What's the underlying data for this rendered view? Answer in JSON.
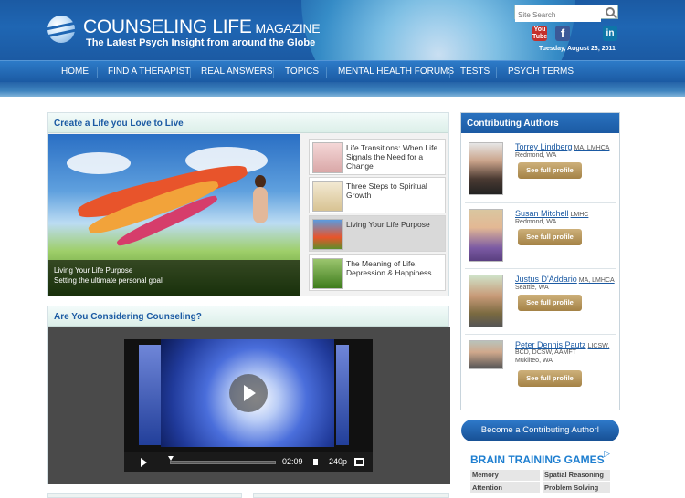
{
  "header": {
    "brand": "COUNSELING LIFE",
    "brand_suffix": "MAGAZINE",
    "tagline": "The Latest Psych Insight from around the Globe",
    "search_placeholder": "Site Search",
    "youtube_label": "You Tube",
    "facebook_label": "f",
    "linkedin_label": "in",
    "date": "Tuesday, August 23, 2011"
  },
  "nav": {
    "items": [
      "HOME",
      "FIND A THERAPIST",
      "REAL ANSWERS",
      "TOPICS",
      "MENTAL HEALTH FORUMS",
      "TESTS",
      "PSYCH TERMS"
    ]
  },
  "feature": {
    "title": "Create a Life you Love to Live",
    "caption_title": "Living Your Life Purpose",
    "caption_sub": "Setting the ultimate personal goal",
    "articles": [
      "Life Transitions: When Life Signals the Need for a Change",
      "Three Steps to Spiritual Growth",
      "Living Your Life Purpose",
      "The Meaning of Life, Depression & Happiness"
    ]
  },
  "video": {
    "title": "Are You Considering Counseling?",
    "time": "02:09",
    "quality": "240p",
    "progress": 0.0
  },
  "authors": {
    "title": "Contributing Authors",
    "button": "See full profile",
    "list": [
      {
        "name": "Torrey Lindberg",
        "cred": "MA, LMHCA",
        "loc": "Redmond, WA"
      },
      {
        "name": "Susan Mitchell",
        "cred": "LMHC",
        "loc": "Redmond, WA"
      },
      {
        "name": "Justus D'Addario",
        "cred": "MA, LMHCA",
        "loc": "Seattle, WA"
      },
      {
        "name": "Peter Dennis Pautz",
        "cred": "LICSW,",
        "cred2": "BCD, DCSW, AAMFT",
        "loc": "Mukilteo, WA"
      }
    ],
    "become": "Become a Contributing Author!"
  },
  "brain": {
    "title": "BRAIN TRAINING GAMES",
    "games": [
      "Memory",
      "Spatial Reasoning",
      "Attention",
      "Problem Solving"
    ]
  },
  "colors": {
    "brand_blue": "#1b5aa3",
    "profile_gold": "#b8975a"
  }
}
